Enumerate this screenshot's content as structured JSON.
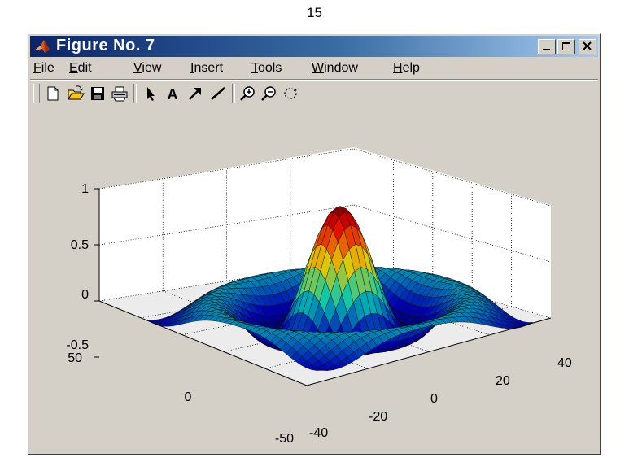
{
  "page_number": "15",
  "window": {
    "title": "Figure No. 7",
    "controls": [
      "minimize-icon",
      "maximize-icon",
      "close-icon"
    ]
  },
  "menu": {
    "items": [
      {
        "prefix": "",
        "accel": "F",
        "rest": "ile"
      },
      {
        "prefix": "",
        "accel": "E",
        "rest": "dit"
      },
      {
        "prefix": "",
        "accel": "V",
        "rest": "iew"
      },
      {
        "prefix": "",
        "accel": "I",
        "rest": "nsert"
      },
      {
        "prefix": "",
        "accel": "T",
        "rest": "ools"
      },
      {
        "prefix": "",
        "accel": "W",
        "rest": "indow"
      },
      {
        "prefix": "",
        "accel": "H",
        "rest": "elp"
      }
    ]
  },
  "toolbar": {
    "icons": [
      "new-file-icon",
      "open-folder-icon",
      "save-icon",
      "print-icon",
      "select-arrow-icon",
      "insert-text-icon",
      "insert-arrow-icon",
      "insert-line-icon",
      "zoom-in-icon",
      "zoom-out-icon",
      "rotate-3d-icon"
    ],
    "text_tool_label": "A"
  },
  "chart_data": {
    "type": "surface",
    "description_free": true,
    "function": "sinc-like 3D surface",
    "z_ticks": [
      "1",
      "0.5",
      "0",
      "-0.5"
    ],
    "y_ticks": [
      "50",
      "0",
      "-50"
    ],
    "x_ticks": [
      "-40",
      "-20",
      "0",
      "20",
      "40"
    ],
    "zlim": [
      -0.5,
      1
    ],
    "ylim": [
      -50,
      50
    ],
    "xlim": [
      -40,
      40
    ],
    "colormap": "jet",
    "grid": true,
    "peak": {
      "x": 0,
      "y": 0,
      "z": 1
    }
  }
}
